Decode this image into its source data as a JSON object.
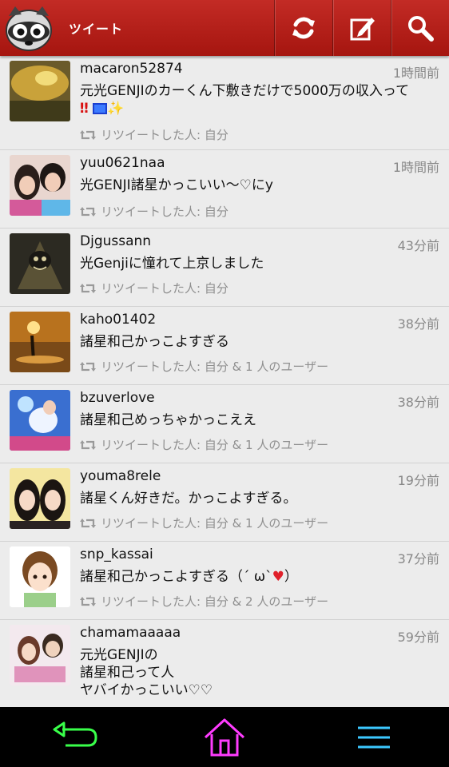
{
  "header": {
    "title": "ツイート",
    "colors": {
      "bar": "#b51d17",
      "icon": "#ffffff"
    }
  },
  "tweets": [
    {
      "user": "macaron52874",
      "time": "1時間前",
      "text": "元光GENJIのカーくん下敷きだけで5000万の収入って",
      "emoji": "‼",
      "rt": "リツイートした人: 自分",
      "avatar": "sunset-field"
    },
    {
      "user": "yuu0621naa",
      "time": "1時間前",
      "text": "光GENJI諸星かっこいい〜♡にy",
      "rt": "リツイートした人: 自分",
      "avatar": "two-friends"
    },
    {
      "user": "Djgussann",
      "time": "43分前",
      "text": "光Genjiに憧れて上京しました",
      "rt": "リツイートした人: 自分",
      "avatar": "dark-graffiti"
    },
    {
      "user": "kaho01402",
      "time": "38分前",
      "text": "諸星和己かっこよすぎる",
      "rt": "リツイートした人: 自分 & 1 人のユーザー",
      "avatar": "beach-sunset"
    },
    {
      "user": "bzuverlove",
      "time": "38分前",
      "text": "諸星和己めっちゃかっこええ",
      "rt": "リツイートした人: 自分 & 1 人のユーザー",
      "avatar": "concert-stage"
    },
    {
      "user": "youma8rele",
      "time": "19分前",
      "text": "諸星くん好きだ。かっこよすぎる。",
      "rt": "リツイートした人: 自分 & 1 人のユーザー",
      "avatar": "purikura"
    },
    {
      "user": "snp_kassai",
      "time": "37分前",
      "text": "諸星和己かっこよすぎる（´ ω`",
      "heart": "♥",
      "text_end": "）",
      "rt": "リツイートした人: 自分 & 2 人のユーザー",
      "avatar": "anime-girl"
    },
    {
      "user": "chamamaaaaa",
      "time": "59分前",
      "text": "元光GENJIの\n諸星和己って人\nヤバイかっこいい♡♡",
      "avatar": "photo-collage"
    }
  ],
  "nav": {
    "back_icon": "back-arrow-icon",
    "home_icon": "home-icon",
    "menu_icon": "menu-icon",
    "colors": {
      "back": "#39ff4a",
      "home": "#ff3cff",
      "menu": "#3cc8ff"
    }
  }
}
